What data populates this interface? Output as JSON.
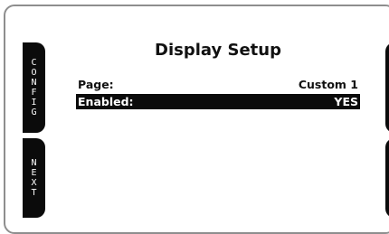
{
  "softkeys": {
    "left_top": "CONFIG",
    "left_bottom": "NEXT"
  },
  "screen": {
    "title": "Display Setup",
    "rows": [
      {
        "label": "Page:",
        "value": "Custom 1",
        "selected": false
      },
      {
        "label": "Enabled:",
        "value": "YES",
        "selected": true
      }
    ]
  },
  "colors": {
    "background": "#ffffff",
    "bezel_border": "#8e8e8e",
    "softkey": "#0b0b0b",
    "selection": "#0b0b0b",
    "text": "#111111"
  }
}
